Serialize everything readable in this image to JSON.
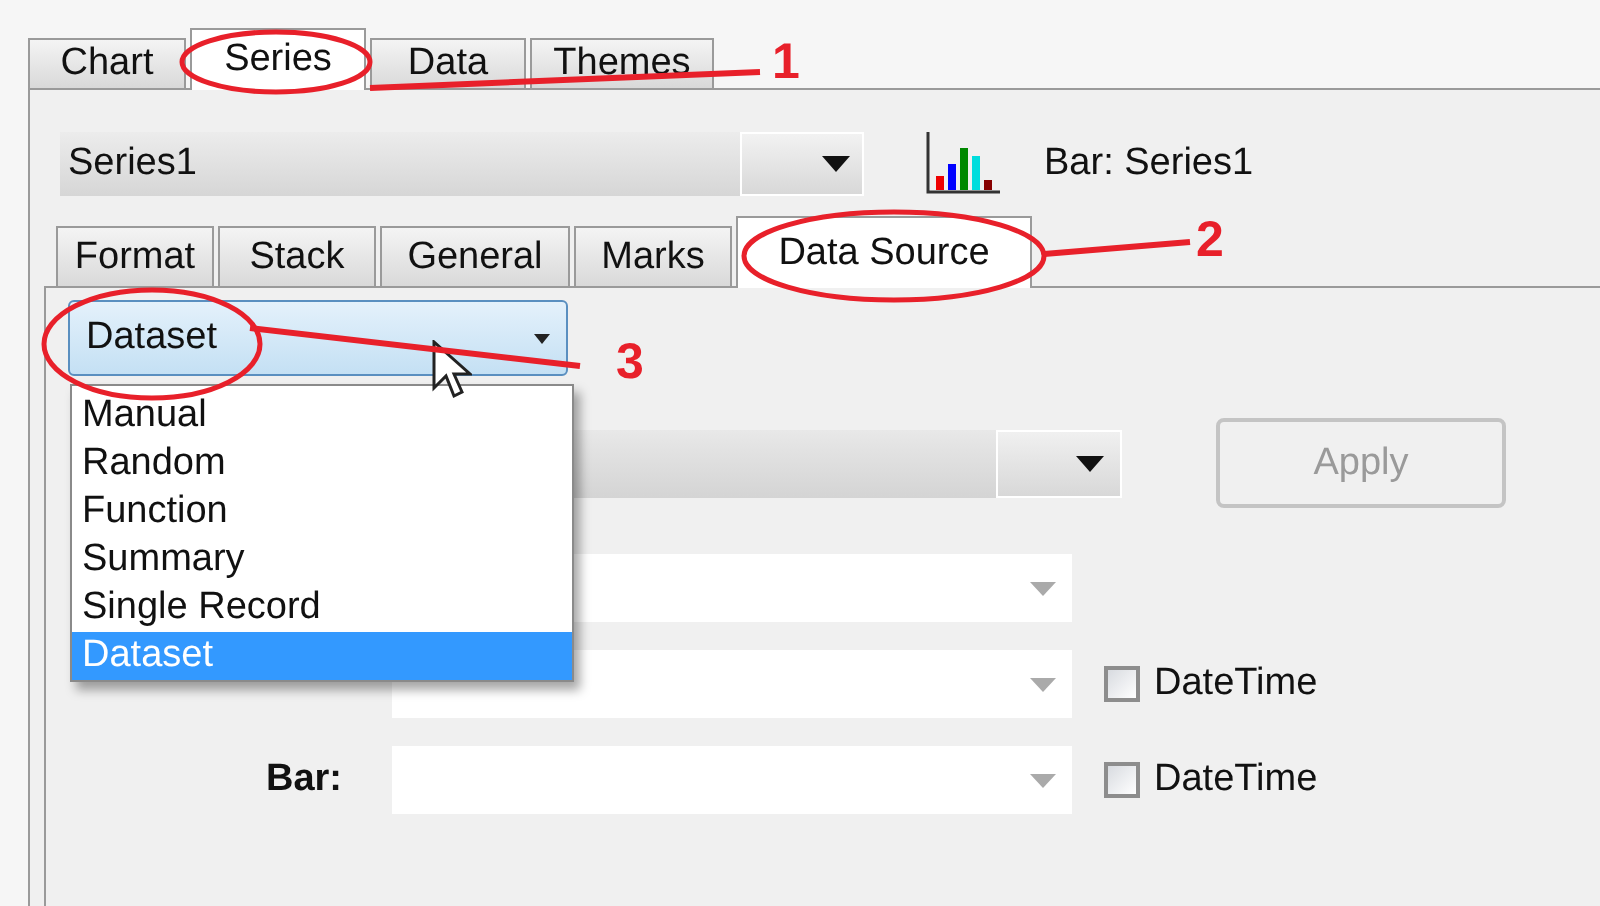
{
  "tabs": [
    {
      "label": "Chart",
      "selected": false
    },
    {
      "label": "Series",
      "selected": true
    },
    {
      "label": "Data",
      "selected": false
    },
    {
      "label": "Themes",
      "selected": false
    }
  ],
  "series_selector": {
    "value": "Series1"
  },
  "series_caption": "Bar: Series1",
  "sub_tabs": [
    {
      "label": "Format",
      "selected": false
    },
    {
      "label": "Stack",
      "selected": false
    },
    {
      "label": "General",
      "selected": false
    },
    {
      "label": "Marks",
      "selected": false
    },
    {
      "label": "Data Source",
      "selected": true
    }
  ],
  "source_dropdown": {
    "value": "Dataset",
    "expanded": true,
    "options": [
      {
        "label": "Manual",
        "selected": false
      },
      {
        "label": "Random",
        "selected": false
      },
      {
        "label": "Function",
        "selected": false
      },
      {
        "label": "Summary",
        "selected": false
      },
      {
        "label": "Single Record",
        "selected": false
      },
      {
        "label": "Dataset",
        "selected": true
      }
    ]
  },
  "apply_button": {
    "label": "Apply",
    "disabled": true
  },
  "fields": [
    {
      "kind": "plain"
    },
    {
      "kind": "datetime",
      "checkbox_label": "DateTime",
      "checked": false
    },
    {
      "kind": "datetime",
      "label": "Bar:",
      "checkbox_label": "DateTime",
      "checked": false
    }
  ],
  "annotations": [
    {
      "number": "1"
    },
    {
      "number": "2"
    },
    {
      "number": "3"
    }
  ]
}
